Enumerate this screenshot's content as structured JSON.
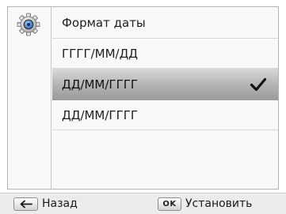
{
  "menu": {
    "title": "Формат даты",
    "options": [
      "ГГГГ/ММ/ДД",
      "ДД/ММ/ГГГГ",
      "ДД/ММ/ГГГГ"
    ],
    "selected_index": 1
  },
  "bottom_bar": {
    "back_key": "↩",
    "back_label": "Назад",
    "ok_key": "OK",
    "ok_label": "Установить"
  },
  "icons": {
    "settings": "gear-icon",
    "check": "checkmark-icon",
    "back": "return-arrow-icon"
  },
  "colors": {
    "selection_top": "#d9d9d9",
    "selection_bottom": "#9a9a9a",
    "gear_blue": "#3f7fd6"
  }
}
